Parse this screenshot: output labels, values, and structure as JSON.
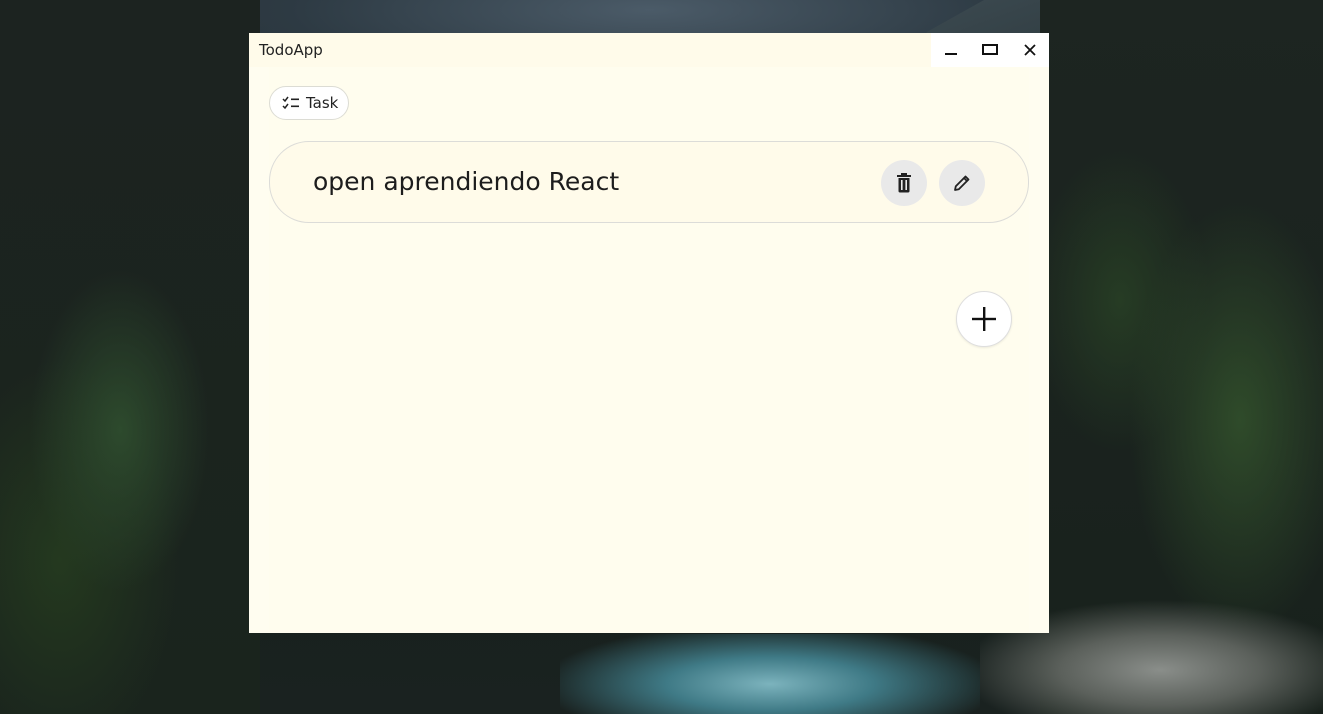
{
  "window": {
    "title": "TodoApp"
  },
  "filter_chip": {
    "label": "Task",
    "icon": "checklist-icon"
  },
  "tasks": [
    {
      "title": "open aprendiendo React",
      "delete_icon": "trash-icon",
      "edit_icon": "pencil-icon"
    }
  ],
  "fab": {
    "icon": "plus-icon"
  },
  "colors": {
    "window_bg": "#fffdf0",
    "card_bg": "#fffbea",
    "action_bg": "#e9e9e9"
  }
}
